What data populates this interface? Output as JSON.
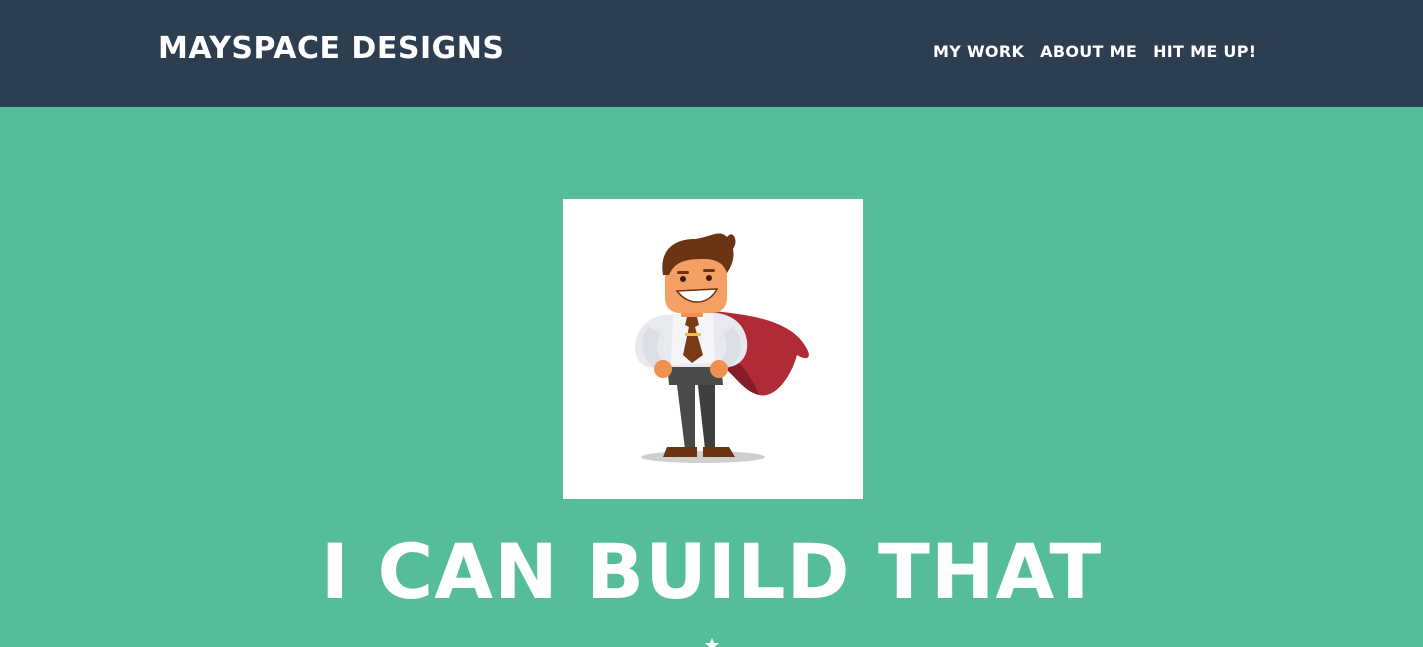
{
  "navbar": {
    "brand": "MAYSPACE DESIGNS",
    "links": [
      {
        "label": "MY WORK"
      },
      {
        "label": "ABOUT ME"
      },
      {
        "label": "HIT ME UP!"
      }
    ]
  },
  "hero": {
    "avatar_icon": "superhero-businessman-illustration",
    "title": "I CAN BUILD THAT",
    "divider_icon": "star-icon"
  },
  "colors": {
    "navbar_bg": "#2c3e50",
    "hero_bg": "#55bc9c",
    "text": "#ffffff",
    "cape": "#b02a37"
  }
}
